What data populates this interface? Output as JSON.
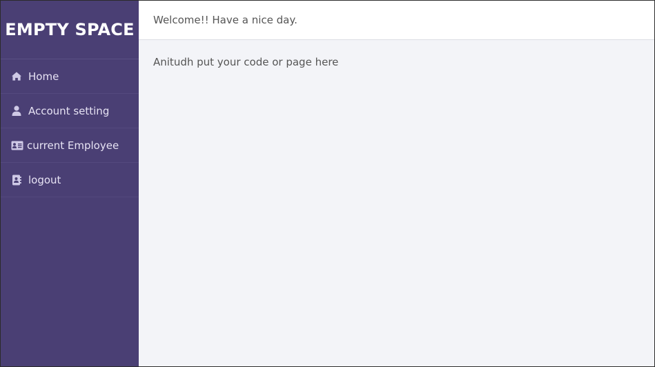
{
  "sidebar": {
    "brand": "EMPTY SPACE",
    "items": [
      {
        "label": "Home",
        "icon": "home-icon"
      },
      {
        "label": "Account setting",
        "icon": "user-icon"
      },
      {
        "label": "current Employee",
        "icon": "id-card-icon"
      },
      {
        "label": "logout",
        "icon": "address-book-icon"
      }
    ]
  },
  "header": {
    "welcome": "Welcome!! Have a nice day."
  },
  "main": {
    "text": "Anitudh put your code or page here"
  },
  "colors": {
    "sidebar": "#4a3f74",
    "background": "#f3f4f8",
    "header": "#ffffff"
  }
}
